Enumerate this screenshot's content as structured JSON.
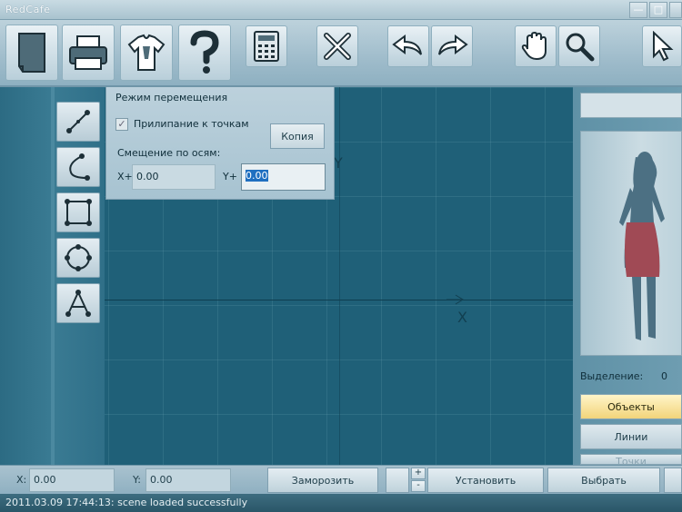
{
  "window": {
    "title": "RedCafe",
    "minimize": "—",
    "maximize": "□"
  },
  "toolbar": {
    "buttons": [
      {
        "id": "new",
        "icon": "document-icon"
      },
      {
        "id": "print",
        "icon": "printer-icon"
      },
      {
        "id": "model",
        "icon": "shirt-icon"
      },
      {
        "id": "help",
        "icon": "question-icon"
      },
      {
        "id": "calc",
        "icon": "calculator-icon"
      },
      {
        "id": "delete",
        "icon": "cross-icon"
      },
      {
        "id": "undo",
        "icon": "undo-icon"
      },
      {
        "id": "redo",
        "icon": "redo-icon"
      },
      {
        "id": "pan",
        "icon": "hand-icon"
      },
      {
        "id": "zoom",
        "icon": "magnifier-icon"
      },
      {
        "id": "select",
        "icon": "cursor-icon"
      }
    ]
  },
  "tools": [
    {
      "id": "line",
      "icon": "line-tool-icon"
    },
    {
      "id": "curve",
      "icon": "curve-tool-icon"
    },
    {
      "id": "rect",
      "icon": "rectangle-tool-icon"
    },
    {
      "id": "circle",
      "icon": "circle-tool-icon"
    },
    {
      "id": "triangle",
      "icon": "triangle-tool-icon"
    }
  ],
  "canvas": {
    "axis_x": "X",
    "axis_y": "Y"
  },
  "move_panel": {
    "title": "Режим перемещения",
    "snap_label": "Прилипание к точкам",
    "snap_checked": true,
    "copy_button": "Копия",
    "offset_label": "Смещение по осям:",
    "x_label": "X+",
    "x_value": "0.00",
    "y_label": "Y+",
    "y_value": "0.00"
  },
  "right_panel": {
    "selection_label": "Выделение:",
    "selection_count": "0",
    "buttons": [
      {
        "label": "Объекты",
        "active": true
      },
      {
        "label": "Линии",
        "active": false
      },
      {
        "label": "Точки",
        "active": false
      }
    ]
  },
  "bottom_bar": {
    "x_label": "X:",
    "x_value": "0.00",
    "y_label": "Y:",
    "y_value": "0.00",
    "freeze_button": "Заморозить",
    "spin_up": "+",
    "spin_down": "-",
    "set_button": "Установить",
    "choose_button": "Выбрать"
  },
  "status": {
    "message": "2011.03.09 17:44:13: scene loaded successfully"
  },
  "colors": {
    "canvas": "#1f6078",
    "accent_active": "#f2d47a"
  }
}
